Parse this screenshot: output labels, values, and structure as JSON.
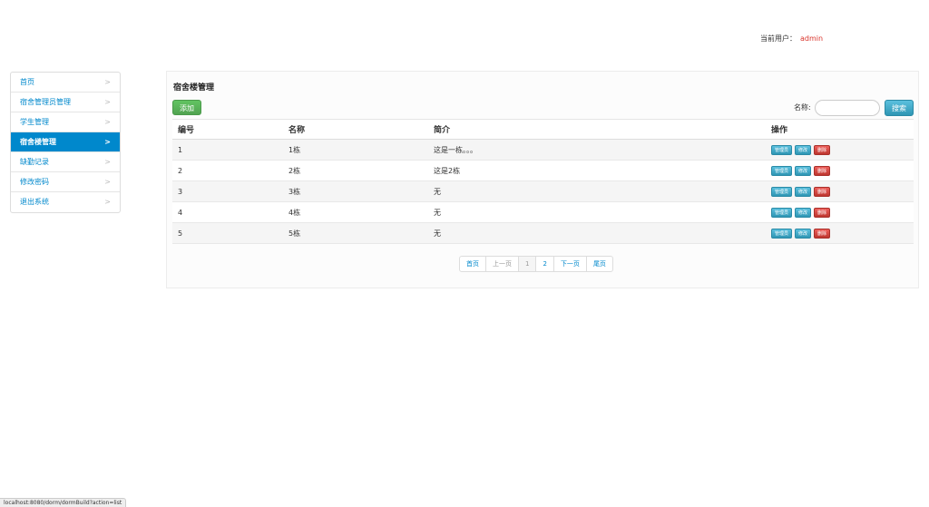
{
  "header": {
    "user_label": "当前用户：",
    "user_name": "admin"
  },
  "sidebar": {
    "items": [
      {
        "label": "首页",
        "active": false
      },
      {
        "label": "宿舍管理员管理",
        "active": false
      },
      {
        "label": "学生管理",
        "active": false
      },
      {
        "label": "宿舍楼管理",
        "active": true
      },
      {
        "label": "缺勤记录",
        "active": false
      },
      {
        "label": "修改密码",
        "active": false
      },
      {
        "label": "退出系统",
        "active": false
      }
    ],
    "chevron": ">"
  },
  "main": {
    "title": "宿舍楼管理",
    "add_label": "添加",
    "search": {
      "label": "名称:",
      "value": "",
      "button_label": "搜索"
    },
    "table": {
      "headers": [
        "编号",
        "名称",
        "简介",
        "操作"
      ],
      "rows": [
        {
          "id": "1",
          "name": "1栋",
          "intro": "这是一栋。。。"
        },
        {
          "id": "2",
          "name": "2栋",
          "intro": "这是2栋"
        },
        {
          "id": "3",
          "name": "3栋",
          "intro": "无"
        },
        {
          "id": "4",
          "name": "4栋",
          "intro": "无"
        },
        {
          "id": "5",
          "name": "5栋",
          "intro": "无"
        }
      ],
      "actions": {
        "manager": "管理员",
        "edit": "修改",
        "delete": "删除"
      }
    },
    "pagination": {
      "first": "首页",
      "prev": "上一页",
      "pages": [
        "1",
        "2"
      ],
      "current": "1",
      "next": "下一页",
      "last": "尾页"
    }
  },
  "status_bar": {
    "url": "localhost:8080/dorm/dormBuild?action=list"
  },
  "colors": {
    "accent": "#0088cc",
    "success": "#5bb75b",
    "info": "#49afcd",
    "danger": "#da4f49",
    "user_name": "#d9342b"
  }
}
